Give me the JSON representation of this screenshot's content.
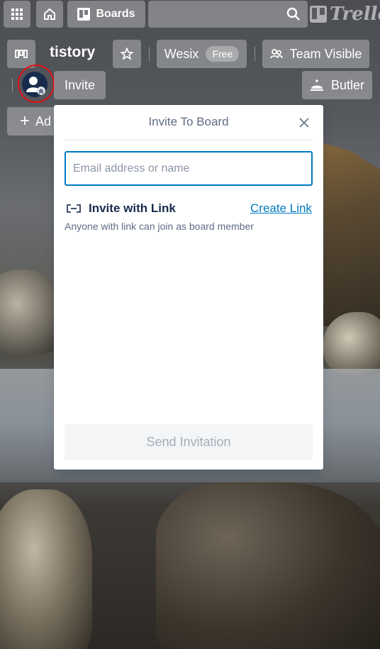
{
  "topbar": {
    "apps_icon": "apps-grid-icon",
    "home_icon": "home-icon",
    "boards_label": "Boards",
    "boards_icon": "boards-icon",
    "search_icon": "search-icon",
    "logo_text": "Trello"
  },
  "board": {
    "switcher_icon": "board-switcher-icon",
    "title": "tistory",
    "star_icon": "star-icon",
    "team_name": "Wesix",
    "team_badge": "Free",
    "visibility_label": "Team Visible",
    "visibility_icon": "team-visibility-icon",
    "member_avatar_icon": "member-avatar-icon",
    "invite_label": "Invite",
    "butler_label": "Butler",
    "butler_icon": "butler-bell-icon",
    "add_list_partial": "Ad"
  },
  "invite_popover": {
    "title": "Invite To Board",
    "close_icon": "close-icon",
    "email_placeholder": "Email address or name",
    "email_value": "",
    "link_icon": "link-icon",
    "invite_link_title": "Invite with Link",
    "create_link_label": "Create Link",
    "invite_link_desc": "Anyone with link can join as board member",
    "send_label": "Send Invitation"
  },
  "colors": {
    "accent": "#0079bf",
    "annotation": "#e0101a",
    "avatar_bg": "#172b4d"
  }
}
